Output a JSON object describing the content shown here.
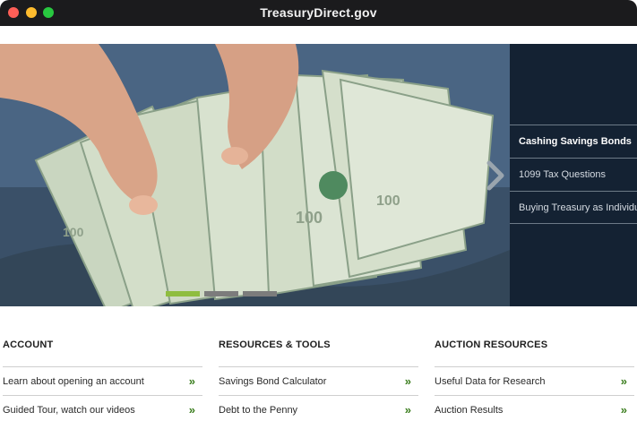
{
  "window": {
    "title": "TreasuryDirect.gov"
  },
  "hero": {
    "image_description_icon": "money-fan-image",
    "panel_items": [
      {
        "label": "Cashing Savings Bonds"
      },
      {
        "label": "1099 Tax Questions"
      },
      {
        "label": "Buying Treasury as Individua"
      }
    ],
    "slide_count": 3,
    "active_slide": 1,
    "colors": {
      "panel_bg": "#142233",
      "indicator_active": "#8fbd3f",
      "link_arrow": "#3a7d1d"
    }
  },
  "sections": [
    {
      "heading": "ACCOUNT",
      "links": [
        {
          "label": "Learn about opening an account"
        },
        {
          "label": "Guided Tour, watch our videos"
        }
      ]
    },
    {
      "heading": "RESOURCES & TOOLS",
      "links": [
        {
          "label": "Savings Bond Calculator"
        },
        {
          "label": "Debt to the Penny"
        }
      ]
    },
    {
      "heading": "AUCTION RESOURCES",
      "links": [
        {
          "label": "Useful Data for Research"
        },
        {
          "label": "Auction Results"
        }
      ]
    }
  ],
  "link_arrow_glyph": "»"
}
